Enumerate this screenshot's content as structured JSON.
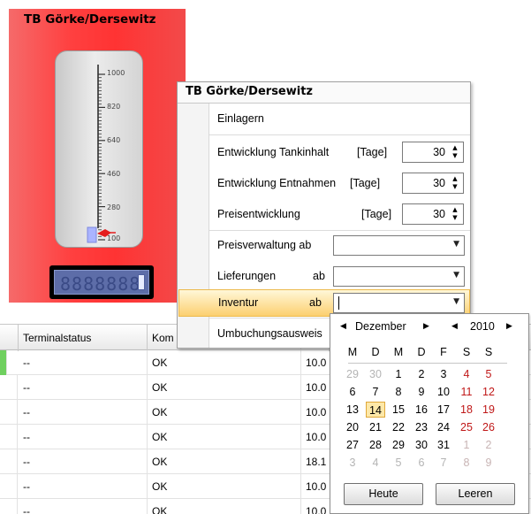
{
  "tank_tile": {
    "title": "TB Görke/Dersewitz",
    "scale_labels": [
      "1000",
      "820",
      "640",
      "460",
      "280",
      "100"
    ],
    "lcd_display": "8888888",
    "colors": {
      "tile_bg": "#ff3b3b",
      "indicator": "#e41c1c",
      "lcd_bg": "#5d6da8"
    }
  },
  "popup": {
    "title": "TB Görke/Dersewitz",
    "items": {
      "einlagern": "Einlagern",
      "tankinhalt": {
        "label": "Entwicklung Tankinhalt",
        "unit": "[Tage]",
        "value": "30"
      },
      "entnahmen": {
        "label": "Entwicklung Entnahmen",
        "unit": "[Tage]",
        "value": "30"
      },
      "preise": {
        "label": "Preisentwicklung",
        "unit": "[Tage]",
        "value": "30"
      },
      "preisverwaltung": {
        "label": "Preisverwaltung ab",
        "value": ""
      },
      "lieferungen": {
        "label": "Lieferungen",
        "ab": "ab",
        "value": ""
      },
      "inventur": {
        "label": "Inventur",
        "ab": "ab",
        "value": ""
      },
      "umbuchung": "Umbuchungsausweis"
    }
  },
  "calendar": {
    "month": "Dezember",
    "year": "2010",
    "weekdays": [
      "M",
      "D",
      "M",
      "D",
      "F",
      "S",
      "S"
    ],
    "weeks": [
      [
        "29",
        "30",
        "1",
        "2",
        "3",
        "4",
        "5"
      ],
      [
        "6",
        "7",
        "8",
        "9",
        "10",
        "11",
        "12"
      ],
      [
        "13",
        "14",
        "15",
        "16",
        "17",
        "18",
        "19"
      ],
      [
        "20",
        "21",
        "22",
        "23",
        "24",
        "25",
        "26"
      ],
      [
        "27",
        "28",
        "29",
        "30",
        "31",
        "1",
        "2"
      ],
      [
        "3",
        "4",
        "5",
        "6",
        "7",
        "8",
        "9"
      ]
    ],
    "today": "14",
    "buttons": {
      "today": "Heute",
      "clear": "Leeren"
    }
  },
  "table": {
    "columns": [
      "Terminalstatus",
      "Kom"
    ],
    "rows": [
      {
        "status": "--",
        "komm": "OK",
        "value": "10.0"
      },
      {
        "status": "--",
        "komm": "OK",
        "value": "10.0"
      },
      {
        "status": "--",
        "komm": "OK",
        "value": "10.0"
      },
      {
        "status": "--",
        "komm": "OK",
        "value": "10.0"
      },
      {
        "status": "--",
        "komm": "OK",
        "value": "18.1"
      },
      {
        "status": "--",
        "komm": "OK",
        "value": "10.0"
      },
      {
        "status": "--",
        "komm": "OK",
        "value": "10.0"
      }
    ]
  }
}
